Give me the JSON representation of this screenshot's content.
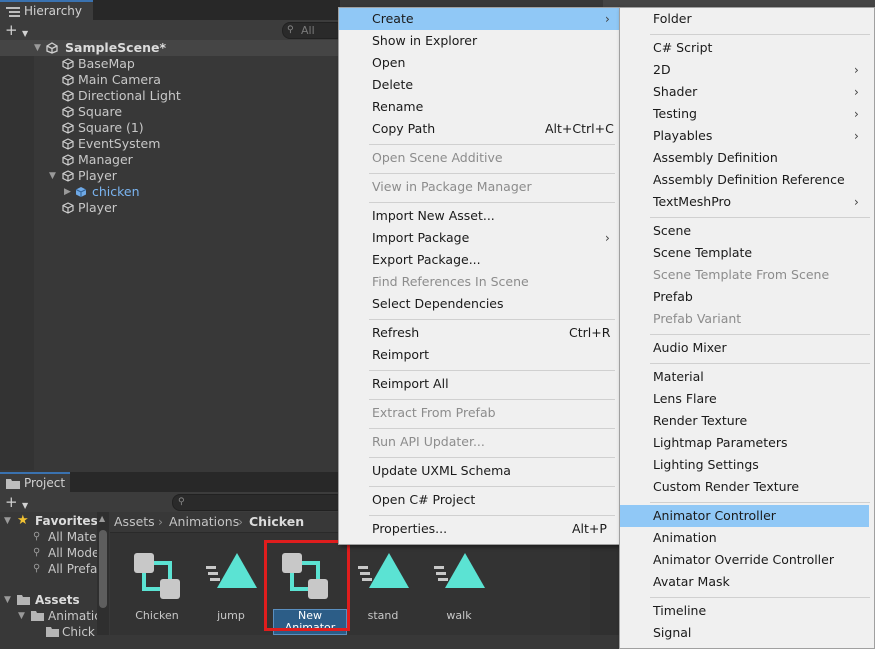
{
  "hierarchy": {
    "tab_label": "Hierarchy",
    "search_placeholder": "All",
    "scene_name": "SampleScene*",
    "items": [
      {
        "label": "BaseMap"
      },
      {
        "label": "Main Camera"
      },
      {
        "label": "Directional Light"
      },
      {
        "label": "Square"
      },
      {
        "label": "Square (1)"
      },
      {
        "label": "EventSystem"
      },
      {
        "label": "Manager"
      },
      {
        "label": "Player"
      },
      {
        "label": "chicken"
      },
      {
        "label": "Player"
      }
    ]
  },
  "project": {
    "tab_label": "Project",
    "favorites_label": "Favorites",
    "favorites_items": [
      "All Mate",
      "All Mode",
      "All Prefa"
    ],
    "assets_label": "Assets",
    "assets_children": [
      "Animatic",
      "Chick"
    ],
    "breadcrumb": [
      "Assets",
      "Animations",
      "Chicken"
    ],
    "assets_grid": [
      {
        "label": "Chicken",
        "icon": "animator-controller-icon"
      },
      {
        "label": "jump",
        "icon": "animation-clip-icon"
      },
      {
        "label": "New Animator",
        "icon": "animator-controller-icon",
        "selected": true
      },
      {
        "label": "stand",
        "icon": "animation-clip-icon"
      },
      {
        "label": "walk",
        "icon": "animation-clip-icon"
      }
    ]
  },
  "context_menu": {
    "items": [
      {
        "label": "Create",
        "submenu": true,
        "highlighted": true
      },
      {
        "label": "Show in Explorer"
      },
      {
        "label": "Open"
      },
      {
        "label": "Delete"
      },
      {
        "label": "Rename"
      },
      {
        "label": "Copy Path",
        "shortcut": "Alt+Ctrl+C"
      },
      {
        "label": "Open Scene Additive",
        "disabled": true
      },
      {
        "label": "View in Package Manager",
        "disabled": true
      },
      {
        "label": "Import New Asset..."
      },
      {
        "label": "Import Package",
        "submenu": true
      },
      {
        "label": "Export Package..."
      },
      {
        "label": "Find References In Scene",
        "disabled": true
      },
      {
        "label": "Select Dependencies"
      },
      {
        "label": "Refresh",
        "shortcut": "Ctrl+R"
      },
      {
        "label": "Reimport"
      },
      {
        "label": "Reimport All"
      },
      {
        "label": "Extract From Prefab",
        "disabled": true
      },
      {
        "label": "Run API Updater...",
        "disabled": true
      },
      {
        "label": "Update UXML Schema"
      },
      {
        "label": "Open C# Project"
      },
      {
        "label": "Properties...",
        "shortcut": "Alt+P"
      }
    ]
  },
  "create_submenu": {
    "items": [
      {
        "label": "Folder"
      },
      {
        "label": "C# Script"
      },
      {
        "label": "2D",
        "submenu": true
      },
      {
        "label": "Shader",
        "submenu": true
      },
      {
        "label": "Testing",
        "submenu": true
      },
      {
        "label": "Playables",
        "submenu": true
      },
      {
        "label": "Assembly Definition"
      },
      {
        "label": "Assembly Definition Reference"
      },
      {
        "label": "TextMeshPro",
        "submenu": true
      },
      {
        "label": "Scene"
      },
      {
        "label": "Scene Template"
      },
      {
        "label": "Scene Template From Scene",
        "disabled": true
      },
      {
        "label": "Prefab"
      },
      {
        "label": "Prefab Variant",
        "disabled": true
      },
      {
        "label": "Audio Mixer"
      },
      {
        "label": "Material"
      },
      {
        "label": "Lens Flare"
      },
      {
        "label": "Render Texture"
      },
      {
        "label": "Lightmap Parameters"
      },
      {
        "label": "Lighting Settings"
      },
      {
        "label": "Custom Render Texture"
      },
      {
        "label": "Animator Controller",
        "highlighted": true
      },
      {
        "label": "Animation"
      },
      {
        "label": "Animator Override Controller"
      },
      {
        "label": "Avatar Mask"
      },
      {
        "label": "Timeline"
      },
      {
        "label": "Signal"
      }
    ]
  },
  "colors": {
    "menu_highlight": "#90c8f6",
    "selection_outline": "#e01d1d",
    "asset_icon_teal": "#5be3d3",
    "asset_icon_gray": "#c8c8c8"
  }
}
